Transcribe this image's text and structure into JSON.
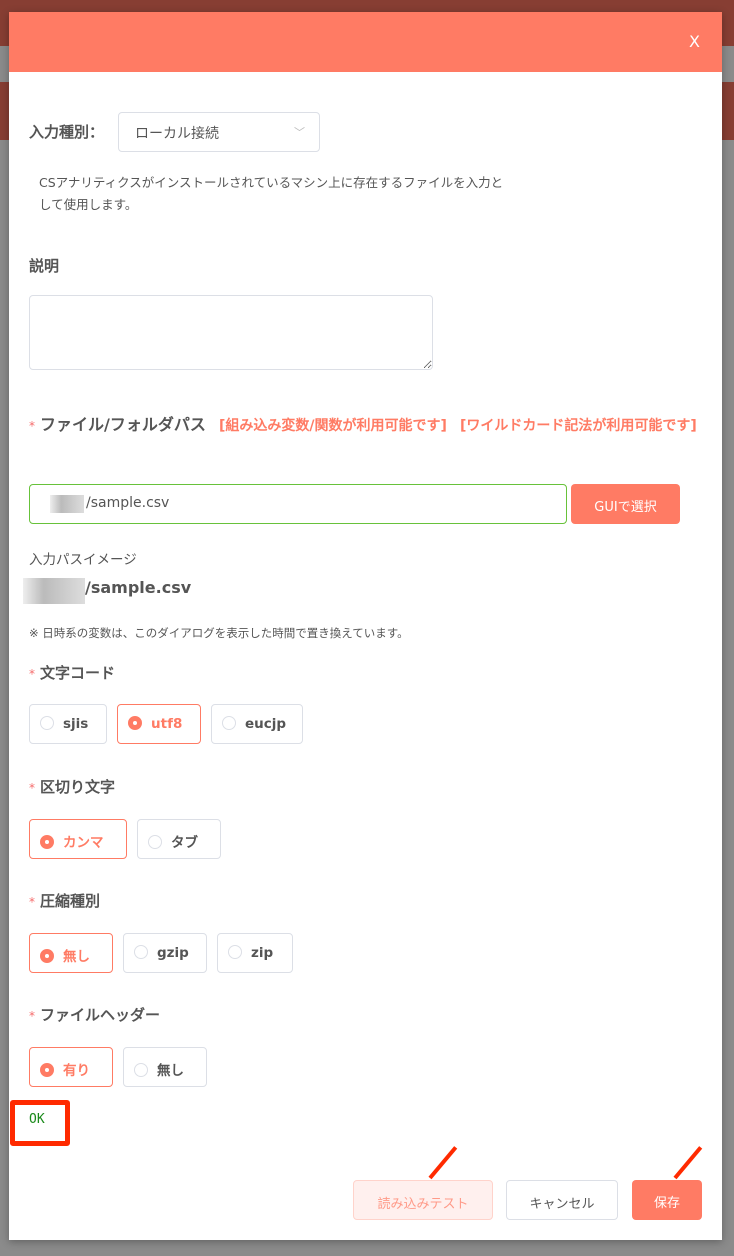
{
  "dialog": {
    "close_label": "X"
  },
  "input_type": {
    "label": "入力種別：",
    "value": "ローカル接続",
    "description": "CSアナリティクスがインストールされているマシン上に存在するファイルを入力として使用します。"
  },
  "description": {
    "label": "説明",
    "value": ""
  },
  "path": {
    "label": "ファイル/フォルダパス",
    "note1": "[組み込み変数/関数が利用可能です]",
    "note2": "[ワイルドカード記法が利用可能です]",
    "value": "/sample.csv",
    "gui_button": "GUIで選択",
    "preview_label": "入力パスイメージ",
    "preview_value": "/sample.csv",
    "footnote": "※ 日時系の変数は、このダイアログを表示した時間で置き換えています。"
  },
  "encoding": {
    "label": "文字コード",
    "options": [
      "sjis",
      "utf8",
      "eucjp"
    ],
    "selected": "utf8"
  },
  "delimiter": {
    "label": "区切り文字",
    "options": [
      "カンマ",
      "タブ"
    ],
    "selected": "カンマ"
  },
  "compression": {
    "label": "圧縮種別",
    "options": [
      "無し",
      "gzip",
      "zip"
    ],
    "selected": "無し"
  },
  "header": {
    "label": "ファイルヘッダー",
    "options": [
      "有り",
      "無し"
    ],
    "selected": "有り"
  },
  "test_result": "OK",
  "footer": {
    "test_button": "読み込みテスト",
    "cancel_button": "キャンセル",
    "save_button": "保存"
  }
}
